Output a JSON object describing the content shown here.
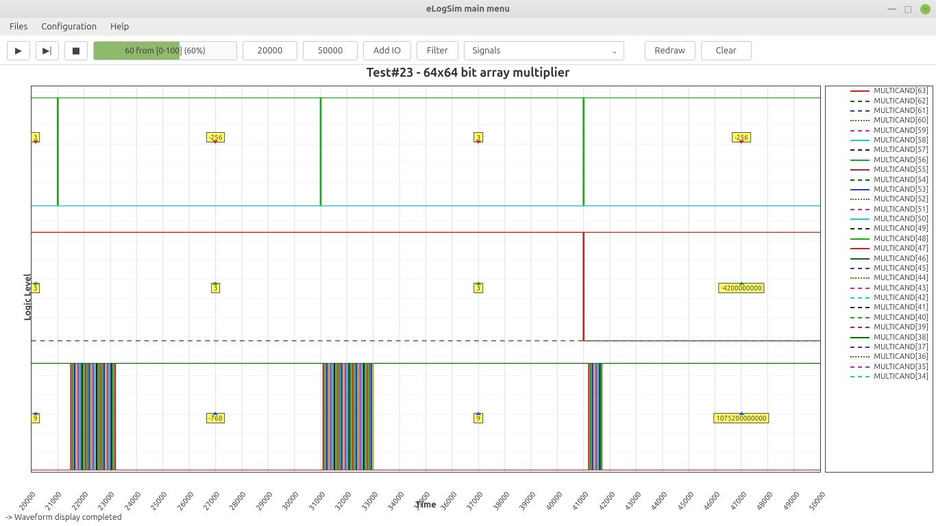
{
  "window": {
    "title": "eLogSim main menu"
  },
  "menu": {
    "files": "Files",
    "config": "Configuration",
    "help": "Help"
  },
  "toolbar": {
    "play": "▶",
    "step": "▶|",
    "stop": "■",
    "progress_text": "60 from [0-100] (60%)",
    "progress_pct": 60,
    "xmin": "20000",
    "xmax": "50000",
    "add_io": "Add IO",
    "filter": "Filter",
    "signals_sel": "Signals",
    "redraw": "Redraw",
    "clear": "Clear"
  },
  "status": {
    "text": "-> Waveform display completed"
  },
  "chart_data": {
    "type": "line",
    "title": "Test#23 - 64x64 bit array multiplier",
    "xlabel": "Time",
    "ylabel": "Logic Level",
    "xlim": [
      20000,
      50000
    ],
    "xticks": [
      20000,
      21000,
      22000,
      23000,
      24000,
      25000,
      26000,
      27000,
      28000,
      29000,
      30000,
      31000,
      32000,
      33000,
      34000,
      35000,
      36000,
      37000,
      38000,
      39000,
      40000,
      41000,
      42000,
      43000,
      44000,
      45000,
      46000,
      47000,
      48000,
      49000,
      50000
    ],
    "bands": [
      {
        "top": 0.03,
        "bottom": 0.31
      },
      {
        "top": 0.37,
        "bottom": 0.66
      },
      {
        "top": 0.71,
        "bottom": 0.995
      }
    ],
    "annotations": [
      {
        "band": 0,
        "x": 20150,
        "text": "3",
        "marker": "red"
      },
      {
        "band": 0,
        "x": 27000,
        "text": "-256",
        "marker": "red"
      },
      {
        "band": 0,
        "x": 37000,
        "text": "3",
        "marker": "red"
      },
      {
        "band": 0,
        "x": 47000,
        "text": "-256",
        "marker": "red"
      },
      {
        "band": 1,
        "x": 20150,
        "text": "3",
        "marker": "green"
      },
      {
        "band": 1,
        "x": 27000,
        "text": "3",
        "marker": "green"
      },
      {
        "band": 1,
        "x": 37000,
        "text": "3",
        "marker": "green"
      },
      {
        "band": 1,
        "x": 47000,
        "text": "-4200000000",
        "marker": "green"
      },
      {
        "band": 2,
        "x": 20150,
        "text": "9",
        "marker": "blue"
      },
      {
        "band": 2,
        "x": 27000,
        "text": "-768",
        "marker": "blue"
      },
      {
        "band": 2,
        "x": 37000,
        "text": "9",
        "marker": "blue"
      },
      {
        "band": 2,
        "x": 47000,
        "text": "1075200000000",
        "marker": "blue"
      }
    ],
    "series_lines": [
      {
        "band": 0,
        "color": "#1aaa1a",
        "style": "solid",
        "segments": [
          [
            20000,
            1
          ],
          [
            21000,
            1
          ],
          [
            21000,
            0
          ],
          [
            31000,
            0
          ],
          [
            31000,
            1
          ],
          [
            41000,
            1
          ],
          [
            41000,
            0
          ],
          [
            50000,
            0
          ]
        ]
      },
      {
        "band": 0,
        "color": "#1aaa1a",
        "style": "solid",
        "segments": [
          [
            20000,
            0
          ],
          [
            21000,
            0
          ],
          [
            21000,
            1
          ],
          [
            31000,
            1
          ],
          [
            31000,
            0
          ],
          [
            41000,
            0
          ],
          [
            41000,
            1
          ],
          [
            50000,
            1
          ]
        ]
      },
      {
        "band": 0,
        "color": "#23c7d6",
        "style": "solid",
        "segments": [
          [
            20000,
            1
          ],
          [
            50000,
            1
          ]
        ]
      },
      {
        "band": 1,
        "color": "#c22121",
        "style": "solid",
        "segments": [
          [
            20000,
            0.03
          ],
          [
            41000,
            0.03
          ],
          [
            41000,
            1
          ],
          [
            50000,
            1
          ]
        ]
      },
      {
        "band": 1,
        "color": "#0a6b0a",
        "style": "dash",
        "segments": [
          [
            20000,
            1
          ],
          [
            50000,
            1
          ]
        ]
      },
      {
        "band": 1,
        "color": "#c22121",
        "style": "solid",
        "segments": [
          [
            20000,
            0.03
          ],
          [
            50000,
            0.03
          ]
        ]
      },
      {
        "band": 2,
        "color": "#0a6b0a",
        "style": "solid",
        "segments": [
          [
            20000,
            0.03
          ],
          [
            50000,
            0.03
          ]
        ]
      },
      {
        "band": 2,
        "color": "#c22121",
        "style": "solid",
        "segments": [
          [
            20000,
            1
          ],
          [
            50000,
            1
          ]
        ]
      }
    ],
    "dense_regions": [
      {
        "band": 2,
        "x0": 21500,
        "x1": 23200
      },
      {
        "band": 2,
        "x0": 31100,
        "x1": 33000
      },
      {
        "band": 2,
        "x0": 41200,
        "x1": 41700
      }
    ],
    "legend": [
      {
        "name": "MULTICAND[63]",
        "color": "#cc1f1f",
        "style": "solid"
      },
      {
        "name": "MULTICAND[62]",
        "color": "#0a6b0a",
        "style": "dash"
      },
      {
        "name": "MULTICAND[61]",
        "color": "#2a3bd0",
        "style": "dash"
      },
      {
        "name": "MULTICAND[60]",
        "color": "#6b6b1f",
        "style": "dot"
      },
      {
        "name": "MULTICAND[59]",
        "color": "#c02bc0",
        "style": "dash"
      },
      {
        "name": "MULTICAND[58]",
        "color": "#22c6d5",
        "style": "solid"
      },
      {
        "name": "MULTICAND[57]",
        "color": "#222",
        "style": "dash"
      },
      {
        "name": "MULTICAND[56]",
        "color": "#1aaa1a",
        "style": "solid"
      },
      {
        "name": "MULTICAND[55]",
        "color": "#cc1f1f",
        "style": "solid"
      },
      {
        "name": "MULTICAND[54]",
        "color": "#0a6b0a",
        "style": "dash"
      },
      {
        "name": "MULTICAND[53]",
        "color": "#2a3bd0",
        "style": "solid"
      },
      {
        "name": "MULTICAND[52]",
        "color": "#6b6b1f",
        "style": "dot"
      },
      {
        "name": "MULTICAND[51]",
        "color": "#c02bc0",
        "style": "dash"
      },
      {
        "name": "MULTICAND[50]",
        "color": "#22c6d5",
        "style": "solid"
      },
      {
        "name": "MULTICAND[49]",
        "color": "#222",
        "style": "dash"
      },
      {
        "name": "MULTICAND[48]",
        "color": "#1aaa1a",
        "style": "solid"
      },
      {
        "name": "MULTICAND[47]",
        "color": "#cc1f1f",
        "style": "solid"
      },
      {
        "name": "MULTICAND[46]",
        "color": "#0a6b0a",
        "style": "solid"
      },
      {
        "name": "MULTICAND[45]",
        "color": "#2a3bd0",
        "style": "dash"
      },
      {
        "name": "MULTICAND[44]",
        "color": "#6b6b1f",
        "style": "dot"
      },
      {
        "name": "MULTICAND[43]",
        "color": "#c02bc0",
        "style": "dash"
      },
      {
        "name": "MULTICAND[42]",
        "color": "#22c6d5",
        "style": "dash"
      },
      {
        "name": "MULTICAND[41]",
        "color": "#222",
        "style": "dash"
      },
      {
        "name": "MULTICAND[40]",
        "color": "#1aaa1a",
        "style": "dash"
      },
      {
        "name": "MULTICAND[39]",
        "color": "#cc1f1f",
        "style": "dash"
      },
      {
        "name": "MULTICAND[38]",
        "color": "#0a6b0a",
        "style": "solid"
      },
      {
        "name": "MULTICAND[37]",
        "color": "#2a3bd0",
        "style": "dash"
      },
      {
        "name": "MULTICAND[36]",
        "color": "#6b6b1f",
        "style": "dot"
      },
      {
        "name": "MULTICAND[35]",
        "color": "#c02bc0",
        "style": "dash"
      },
      {
        "name": "MULTICAND[34]",
        "color": "#22c6d5",
        "style": "dash"
      }
    ]
  }
}
